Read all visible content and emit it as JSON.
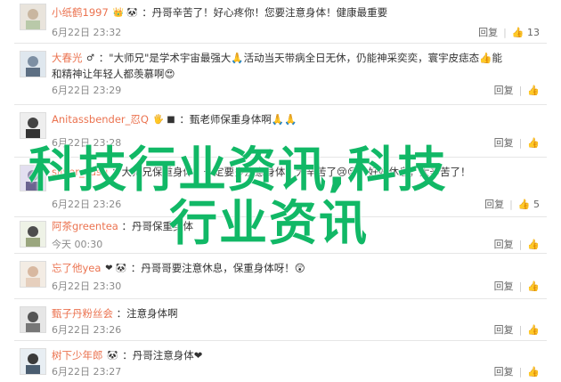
{
  "comments": [
    {
      "user": "小纸鹤1997",
      "badges": "👑 🐼",
      "text": "：丹哥辛苦了！好心疼你！您要注意身体！健康最重要",
      "time": "6月22日 23:32",
      "reply": "回复",
      "likes": "13"
    },
    {
      "user": "大春光",
      "badges": "♂",
      "text": "：\"大师兄\"是学术宇宙最强大🙏活动当天带病全日无休，仍能神采奕奕，寰宇皮痣态👍能",
      "line2": "和精神让年轻人都羡慕啊😍",
      "time": "6月22日 23:29",
      "reply": "回复",
      "likes": ""
    },
    {
      "user": "Anitassbender_忍Q",
      "badges": "🖐 ■",
      "text": "：甄老师保重身体啊🙏🙏",
      "time": "6月22日 23:28",
      "reply": "回复",
      "likes": ""
    },
    {
      "user": "silver_susu",
      "badges": "",
      "text": "：大师兄保重身体，一定要多注意身体，大辛苦了😢😢，好好休息，大辛苦了！",
      "line2": "",
      "time": "6月22日 23:26",
      "reply": "回复",
      "likes": "5"
    },
    {
      "user": "阿茶greentea",
      "badges": "",
      "text": "：丹哥保重身体",
      "time": "今天 00:30",
      "reply": "回复",
      "likes": ""
    },
    {
      "user": "忘了他yea",
      "badges": "❤ 🐼",
      "text": "：丹哥哥要注意休息，保重身体呀！😲",
      "time": "6月22日 23:30",
      "reply": "回复",
      "likes": ""
    },
    {
      "user": "甄子丹粉丝会",
      "badges": "",
      "text": "：注意身体啊",
      "time": "6月22日 23:26",
      "reply": "回复",
      "likes": ""
    },
    {
      "user": "树下少年郎",
      "badges": "🐼",
      "text": "：丹哥注意身体❤",
      "time": "6月22日 23:27",
      "reply": "回复",
      "likes": ""
    }
  ],
  "overlay": {
    "line1": "科技行业资讯,科技",
    "line2": "行业资讯"
  },
  "colors": {
    "username": "#eb7350",
    "overlay_text": "#11b866"
  }
}
